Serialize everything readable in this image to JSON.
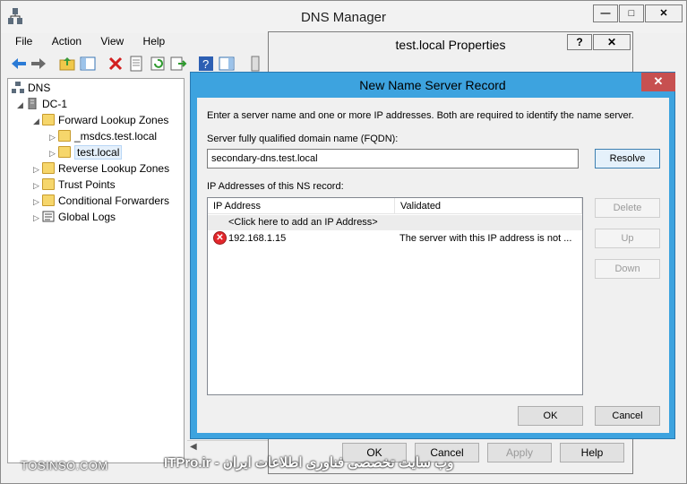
{
  "window": {
    "title": "DNS Manager"
  },
  "menu": [
    "File",
    "Action",
    "View",
    "Help"
  ],
  "toolbar_icons": [
    "back-arrow-icon",
    "forward-arrow-icon",
    "up-folder-icon",
    "show-hide-tree-icon",
    "delete-icon",
    "properties-icon",
    "refresh-icon",
    "export-icon",
    "help-icon",
    "action-pane-icon",
    "more-icon"
  ],
  "tree": {
    "root": "DNS",
    "server": "DC-1",
    "forward": "Forward Lookup Zones",
    "zone1": "_msdcs.test.local",
    "zone2": "test.local",
    "reverse": "Reverse Lookup Zones",
    "trust": "Trust Points",
    "conditional": "Conditional Forwarders",
    "logs": "Global Logs"
  },
  "properties": {
    "title": "test.local Properties",
    "help": "?",
    "close": "✕",
    "ok": "OK",
    "cancel": "Cancel",
    "apply": "Apply",
    "help_btn": "Help"
  },
  "dialog": {
    "title": "New Name Server Record",
    "close": "✕",
    "intro": "Enter a server name and one or more IP addresses.  Both are required to identify the name server.",
    "fqdn_label": "Server fully qualified domain name (FQDN):",
    "fqdn_value": "secondary-dns.test.local",
    "resolve": "Resolve",
    "ip_label": "IP Addresses of this NS record:",
    "columns": [
      "IP Address",
      "Validated"
    ],
    "add_row": "<Click here to add an IP Address>",
    "entry_ip": "192.168.1.15",
    "entry_status": "The server with this IP address is not ...",
    "delete": "Delete",
    "up": "Up",
    "down": "Down",
    "ok": "OK",
    "cancel": "Cancel"
  },
  "watermark": {
    "left": "TOSINSO.COM",
    "right": "ITPro.ir - وب سایت تخصصی فناوری اطلاعات ایران"
  },
  "colors": {
    "dialog_frame": "#3da3df",
    "close_red": "#c75050",
    "error_red": "#e3262b"
  }
}
